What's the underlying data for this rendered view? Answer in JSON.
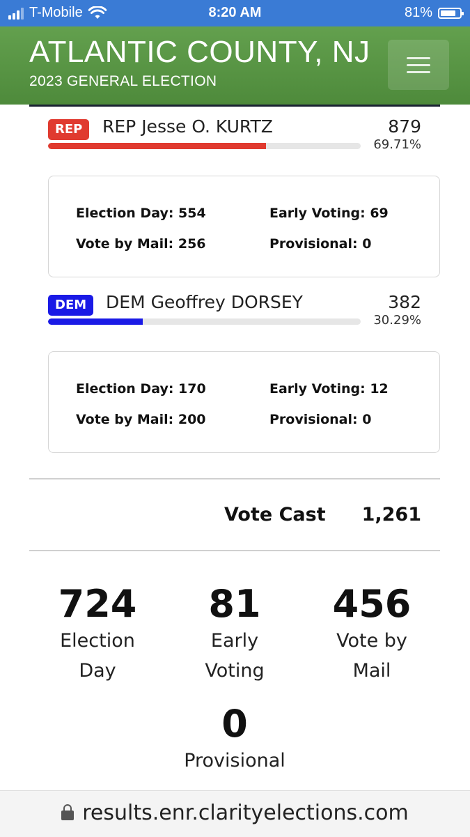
{
  "status_bar": {
    "carrier": "T-Mobile",
    "time": "8:20 AM",
    "battery_percent": "81%",
    "battery_level": 0.81,
    "icons": [
      "signal-icon",
      "wifi-icon",
      "battery-icon"
    ]
  },
  "header": {
    "title": "ATLANTIC COUNTY, NJ",
    "subtitle": "2023 GENERAL ELECTION",
    "menu_icon": "hamburger-menu-icon"
  },
  "colors": {
    "status_bar": "#3a7bd5",
    "header": "#5a9647",
    "rep": "#e03a2f",
    "dem": "#1a1ae6"
  },
  "candidates": [
    {
      "party_badge": "REP",
      "name": "REP Jesse O. KURTZ",
      "votes": "879",
      "percent": "69.71%",
      "share": 0.6971,
      "color": "#e03a2f",
      "breakdown": {
        "election_day": "Election Day: 554",
        "early_voting": "Early Voting: 69",
        "vote_by_mail": "Vote by Mail: 256",
        "provisional": "Provisional: 0"
      }
    },
    {
      "party_badge": "DEM",
      "name": "DEM Geoffrey DORSEY",
      "votes": "382",
      "percent": "30.29%",
      "share": 0.3029,
      "color": "#1a1ae6",
      "breakdown": {
        "election_day": "Election Day: 170",
        "early_voting": "Early Voting: 12",
        "vote_by_mail": "Vote by Mail: 200",
        "provisional": "Provisional: 0"
      }
    }
  ],
  "vote_cast": {
    "label": "Vote Cast",
    "value": "1,261"
  },
  "summary": {
    "election_day": {
      "value": "724",
      "label_line1": "Election",
      "label_line2": "Day"
    },
    "early_voting": {
      "value": "81",
      "label_line1": "Early",
      "label_line2": "Voting"
    },
    "vote_by_mail": {
      "value": "456",
      "label_line1": "Vote by",
      "label_line2": "Mail"
    },
    "provisional": {
      "value": "0",
      "label_line1": "Provisional"
    }
  },
  "browser": {
    "url": "results.enr.clarityelections.com",
    "lock_icon": "lock-icon"
  }
}
